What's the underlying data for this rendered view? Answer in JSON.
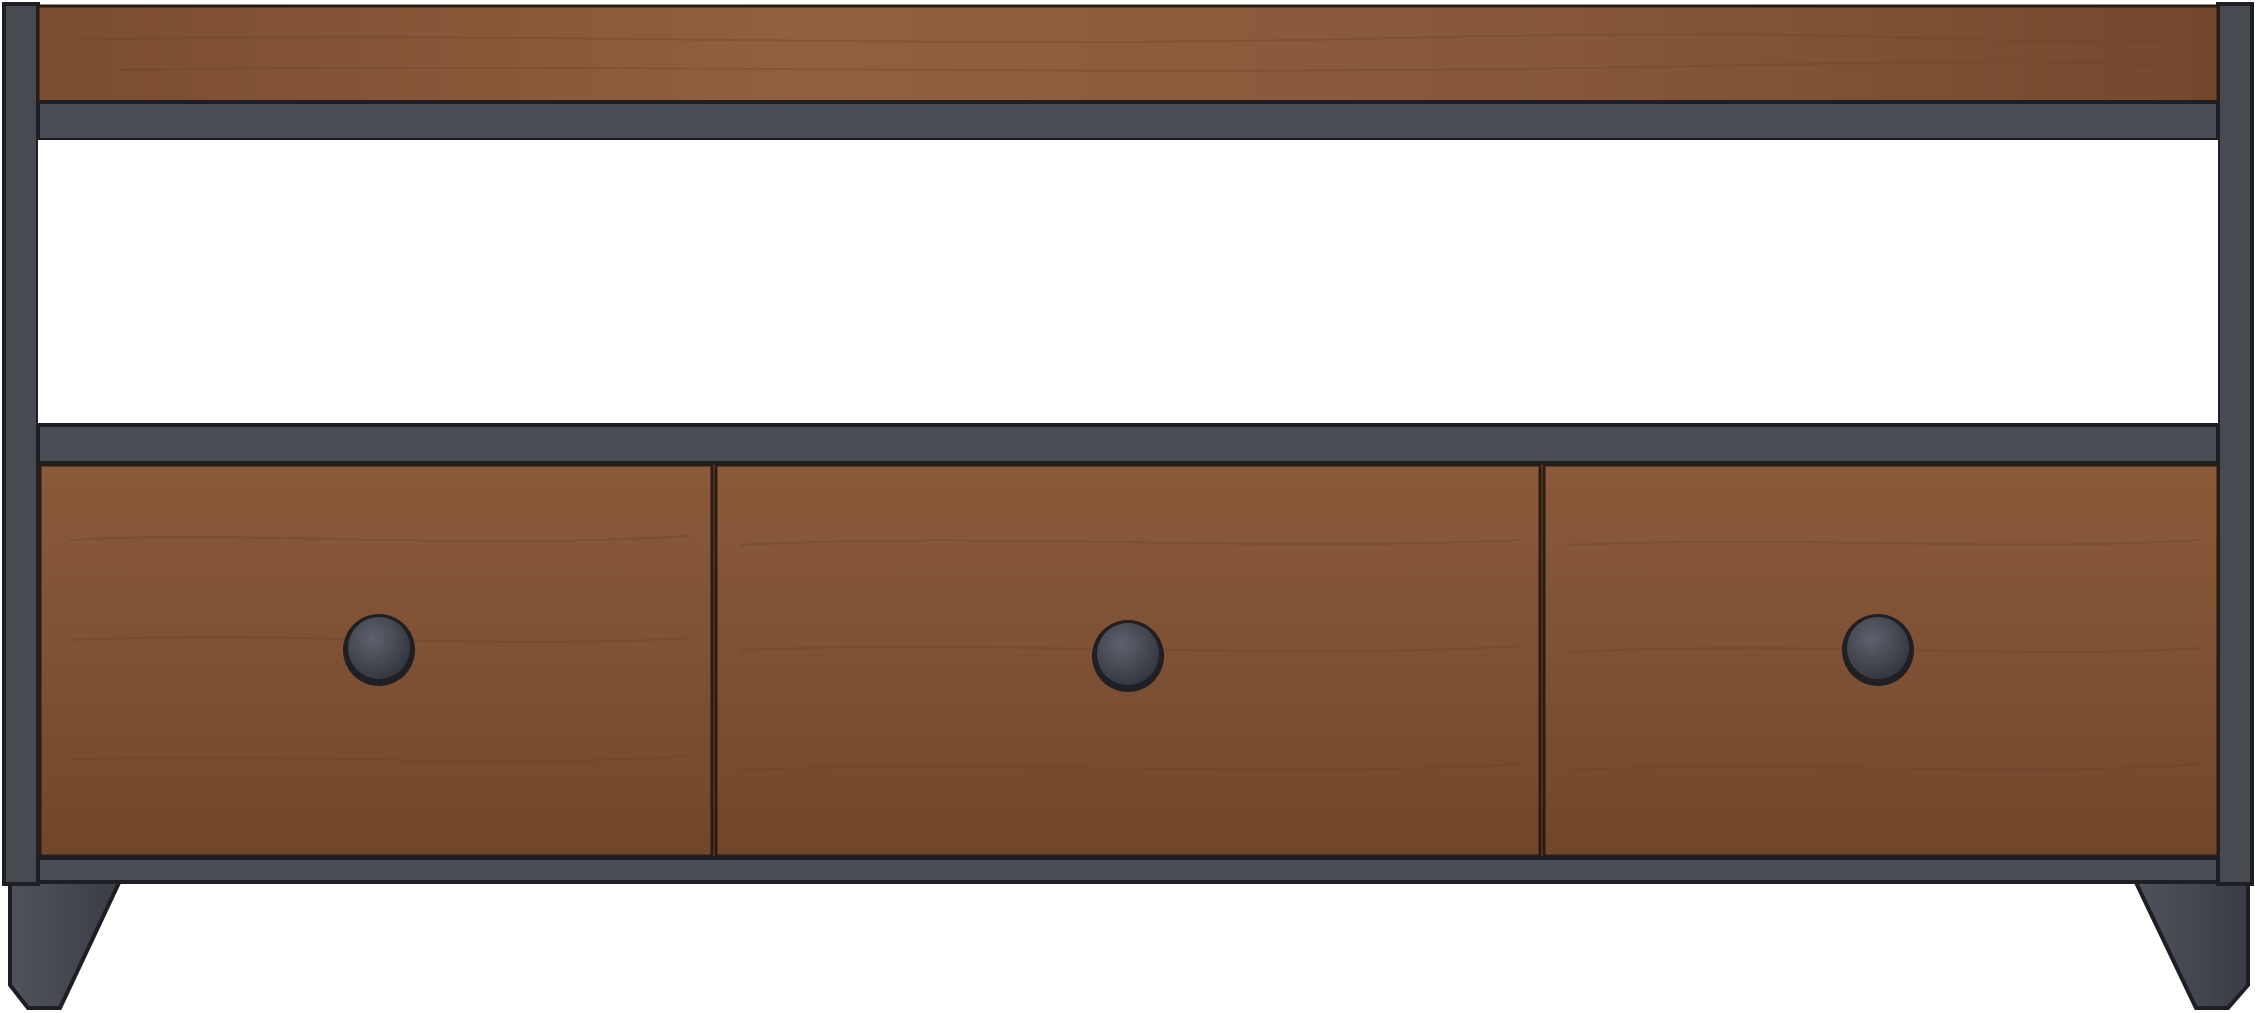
{
  "scene": {
    "subject": "tv-stand-console",
    "background_color": "#ffffff"
  },
  "colors": {
    "frame": "#4a4c54",
    "frame_dark": "#2f3037",
    "frame_edge": "#1e1f24",
    "wood_top": "#8c5a3a",
    "wood_mid": "#7f5133",
    "wood_light": "#9a6845",
    "knob": "#3d3f48",
    "knob_highlight": "#60636e"
  },
  "drawers": [
    {
      "name": "left"
    },
    {
      "name": "center"
    },
    {
      "name": "right"
    }
  ],
  "icons": {
    "knob": "round-knob-icon"
  }
}
